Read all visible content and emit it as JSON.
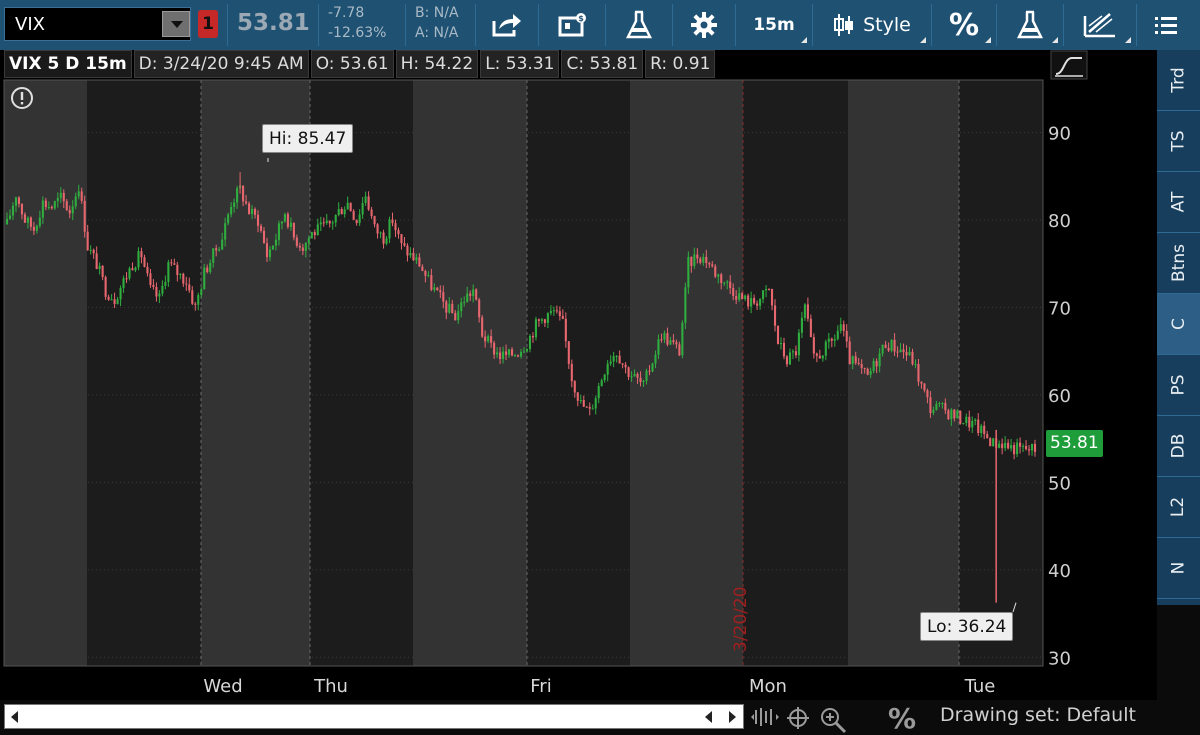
{
  "toolbar": {
    "symbol": "VIX",
    "link_badge": "1",
    "last_price": "53.81",
    "net_change": "-7.78",
    "pct_change": "-12.63%",
    "bid": "B: N/A",
    "ask": "A: N/A",
    "interval_label": "15m",
    "style_label": "Style",
    "pct_label": "%",
    "icons": [
      "share-icon",
      "market-watch-icon",
      "flask-icon",
      "gear-icon",
      "candlestick-icon",
      "flask-icon",
      "drawing-icon",
      "menu-icon"
    ]
  },
  "info_strip": {
    "title": "VIX 5 D 15m",
    "date": "D: 3/24/20 9:45 AM",
    "open": "O: 53.61",
    "high": "H: 54.22",
    "low": "L: 53.31",
    "close": "C: 53.81",
    "range": "R: 0.91"
  },
  "side_tabs": [
    "Trd",
    "TS",
    "AT",
    "Btns",
    "C",
    "PS",
    "DB",
    "L2",
    "N"
  ],
  "side_tab_active": "C",
  "callouts": {
    "hi": "Hi: 85.47",
    "lo": "Lo: 36.24",
    "last": "53.81",
    "date_marker": "3/20/20"
  },
  "bottom": {
    "drawing_set": "Drawing set: Default",
    "pct_label": "%"
  },
  "colors": {
    "toolbar_bg": "#1f5173",
    "up_candle": "#2fae3f",
    "down_candle": "#e8676f",
    "last_tag": "#1f9d3a",
    "session_light": "#333333",
    "session_dark": "#1c1c1c"
  },
  "chart_data": {
    "type": "candlestick",
    "symbol": "VIX",
    "interval": "15m",
    "ylim": [
      29,
      96
    ],
    "yticks": [
      30,
      40,
      50,
      60,
      70,
      80,
      90
    ],
    "day_labels": [
      "Wed",
      "Thu",
      "Fri",
      "Mon",
      "Tue"
    ],
    "grid": true,
    "date_marker": "3/20/20",
    "hi": 85.47,
    "lo": 36.24,
    "last": 53.81,
    "close_path": [
      [
        0,
        79.5
      ],
      [
        3,
        83
      ],
      [
        6,
        80
      ],
      [
        9,
        79
      ],
      [
        12,
        82
      ],
      [
        15,
        81.5
      ],
      [
        18,
        82.5
      ],
      [
        21,
        81
      ],
      [
        24,
        84
      ],
      [
        27,
        77
      ],
      [
        30,
        75
      ],
      [
        33,
        72
      ],
      [
        36,
        71
      ],
      [
        39,
        73
      ],
      [
        42,
        75
      ],
      [
        45,
        76
      ],
      [
        48,
        72
      ],
      [
        51,
        71
      ],
      [
        54,
        75
      ],
      [
        57,
        74
      ],
      [
        60,
        73
      ],
      [
        63,
        70
      ],
      [
        66,
        74
      ],
      [
        69,
        76
      ],
      [
        72,
        78
      ],
      [
        75,
        82
      ],
      [
        78,
        83.5
      ],
      [
        81,
        81
      ],
      [
        84,
        80
      ],
      [
        87,
        76
      ],
      [
        90,
        78
      ],
      [
        93,
        81
      ],
      [
        96,
        78
      ],
      [
        99,
        77
      ],
      [
        102,
        78.5
      ],
      [
        105,
        79
      ],
      [
        108,
        79.5
      ],
      [
        111,
        81
      ],
      [
        114,
        82
      ],
      [
        117,
        80
      ],
      [
        120,
        83
      ],
      [
        123,
        79
      ],
      [
        126,
        78
      ],
      [
        129,
        80
      ],
      [
        132,
        77
      ],
      [
        135,
        76
      ],
      [
        138,
        75
      ],
      [
        141,
        73
      ],
      [
        144,
        71.5
      ],
      [
        147,
        70
      ],
      [
        150,
        69
      ],
      [
        153,
        71
      ],
      [
        156,
        72
      ],
      [
        159,
        67
      ],
      [
        162,
        65.5
      ],
      [
        165,
        64.5
      ],
      [
        168,
        64.5
      ],
      [
        171,
        65
      ],
      [
        174,
        66
      ],
      [
        177,
        68
      ],
      [
        180,
        69
      ],
      [
        183,
        69.5
      ],
      [
        186,
        68
      ],
      [
        189,
        62
      ],
      [
        192,
        59
      ],
      [
        195,
        58
      ],
      [
        198,
        61
      ],
      [
        201,
        64
      ],
      [
        204,
        65
      ],
      [
        207,
        63
      ],
      [
        210,
        62
      ],
      [
        213,
        61
      ],
      [
        216,
        64
      ],
      [
        219,
        67
      ],
      [
        222,
        66
      ],
      [
        225,
        65
      ],
      [
        228,
        75
      ],
      [
        231,
        76
      ],
      [
        234,
        75.5
      ],
      [
        237,
        74
      ],
      [
        240,
        73
      ],
      [
        243,
        72
      ],
      [
        246,
        71
      ],
      [
        249,
        70.5
      ],
      [
        252,
        71
      ],
      [
        255,
        72
      ],
      [
        258,
        66
      ],
      [
        261,
        64
      ],
      [
        264,
        65
      ],
      [
        267,
        70
      ],
      [
        270,
        64
      ],
      [
        273,
        65
      ],
      [
        276,
        66
      ],
      [
        279,
        68
      ],
      [
        282,
        64
      ],
      [
        285,
        63
      ],
      [
        288,
        62
      ],
      [
        291,
        64
      ],
      [
        294,
        66
      ],
      [
        297,
        65.5
      ],
      [
        300,
        65
      ],
      [
        303,
        64
      ],
      [
        306,
        61
      ],
      [
        309,
        58.5
      ],
      [
        312,
        58.5
      ],
      [
        315,
        58
      ],
      [
        318,
        57.5
      ],
      [
        321,
        57
      ],
      [
        324,
        56.5
      ],
      [
        327,
        55.5
      ],
      [
        330,
        54.5
      ],
      [
        333,
        54.5
      ],
      [
        336,
        54
      ],
      [
        339,
        53.8
      ]
    ]
  }
}
